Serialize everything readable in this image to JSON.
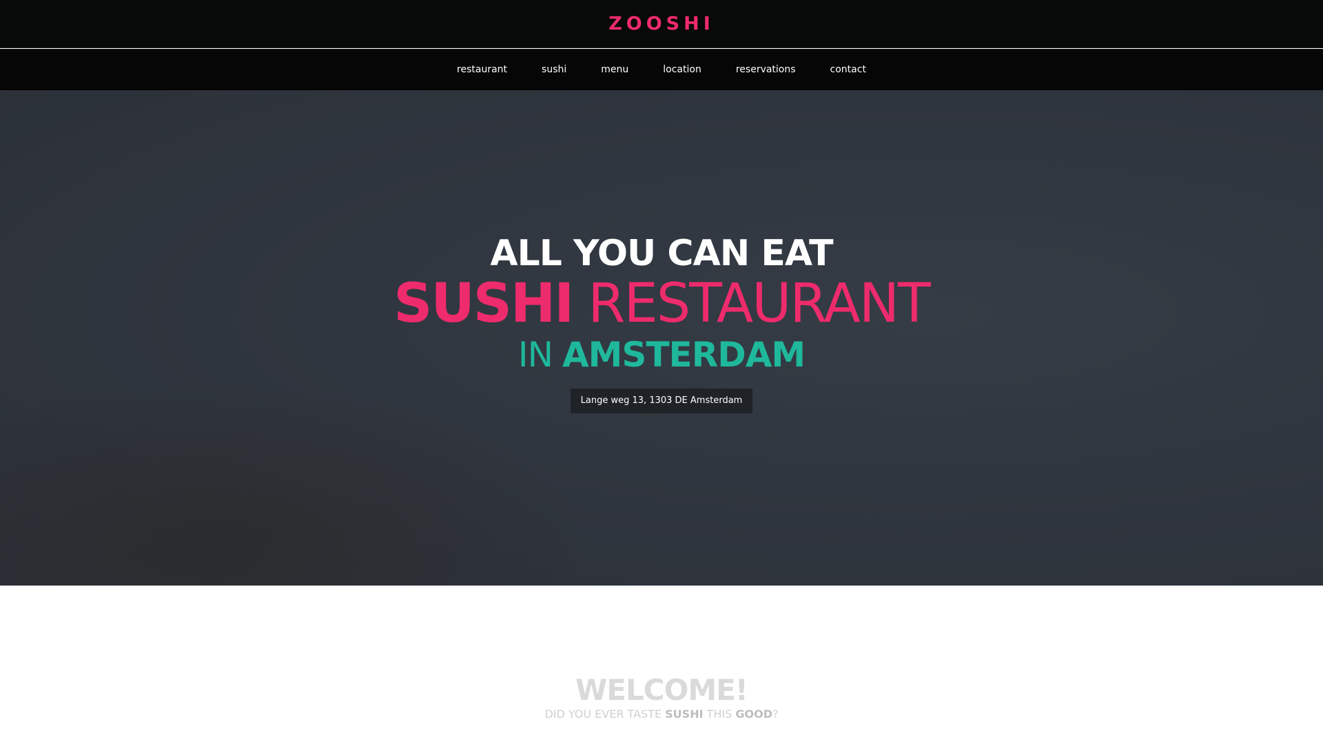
{
  "brand": {
    "logo": "ZOOSHI"
  },
  "nav": {
    "items": [
      {
        "label": "restaurant"
      },
      {
        "label": "sushi"
      },
      {
        "label": "menu"
      },
      {
        "label": "location"
      },
      {
        "label": "reservations"
      },
      {
        "label": "contact"
      }
    ]
  },
  "hero": {
    "line1": "ALL YOU CAN EAT",
    "line2_strong": "SUSHI",
    "line2_light": "RESTAURANT",
    "line3_light": "IN",
    "line3_strong": "AMSTERDAM",
    "address": "Lange weg 13, 1303 DE Amsterdam"
  },
  "welcome": {
    "title": "WELCOME!",
    "sub_part1": "DID YOU EVER TASTE",
    "sub_bold1": "SUSHI",
    "sub_part2": "THIS",
    "sub_bold2": "GOOD",
    "sub_part3": "?"
  },
  "colors": {
    "accent_pink": "#ee2b6c",
    "accent_teal": "#1fb89c",
    "header_bg": "#080909",
    "hero_bg": "#30363f"
  }
}
